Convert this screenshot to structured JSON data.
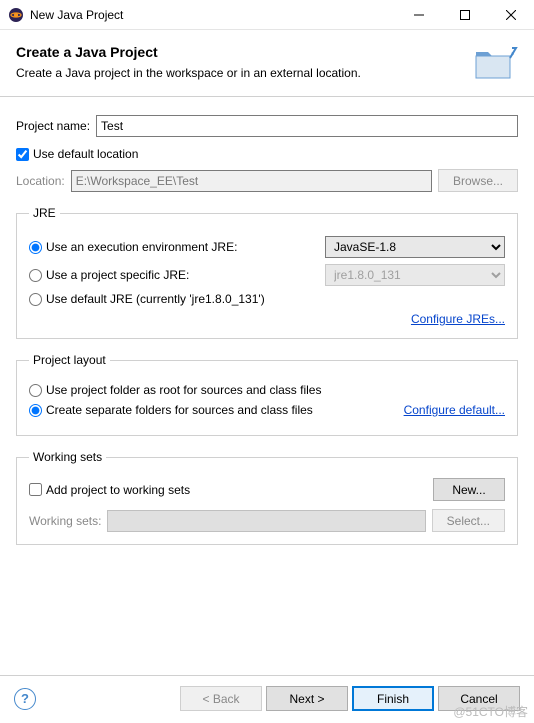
{
  "window": {
    "title": "New Java Project"
  },
  "header": {
    "title": "Create a Java Project",
    "subtitle": "Create a Java project in the workspace or in an external location."
  },
  "project": {
    "name_label": "Project name:",
    "name_value": "Test",
    "use_default_label": "Use default location",
    "use_default_checked": true,
    "location_label": "Location:",
    "location_value": "E:\\Workspace_EE\\Test",
    "browse_label": "Browse..."
  },
  "jre": {
    "legend": "JRE",
    "opt_env_label": "Use an execution environment JRE:",
    "opt_env_value": "JavaSE-1.8",
    "opt_specific_label": "Use a project specific JRE:",
    "opt_specific_value": "jre1.8.0_131",
    "opt_default_label": "Use default JRE (currently 'jre1.8.0_131')",
    "configure_label": "Configure JREs..."
  },
  "layout": {
    "legend": "Project layout",
    "opt_root_label": "Use project folder as root for sources and class files",
    "opt_separate_label": "Create separate folders for sources and class files",
    "configure_label": "Configure default..."
  },
  "ws": {
    "legend": "Working sets",
    "add_label": "Add project to working sets",
    "new_label": "New...",
    "sets_label": "Working sets:",
    "select_label": "Select..."
  },
  "footer": {
    "back": "< Back",
    "next": "Next >",
    "finish": "Finish",
    "cancel": "Cancel"
  },
  "watermark": "@51CTO博客"
}
